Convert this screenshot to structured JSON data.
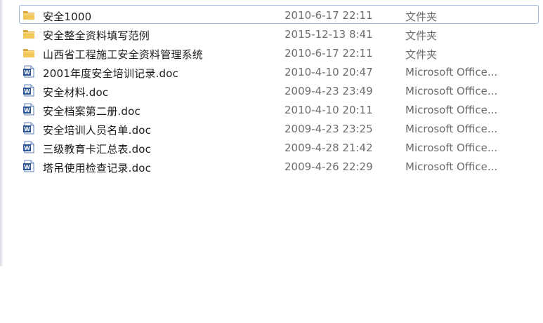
{
  "colors": {
    "folder": "#e8b84a",
    "doc_blue": "#2a5699",
    "selection_border": "#9dbbe0"
  },
  "files": [
    {
      "name": "安全1000",
      "date": "2010-6-17 22:11",
      "type": "文件夹",
      "icon": "folder-icon"
    },
    {
      "name": "安全整全资料填写范例",
      "date": "2015-12-13 8:41",
      "type": "文件夹",
      "icon": "folder-icon"
    },
    {
      "name": "山西省工程施工安全资料管理系统",
      "date": "2010-6-17 22:11",
      "type": "文件夹",
      "icon": "folder-icon"
    },
    {
      "name": "2001年度安全培训记录.doc",
      "date": "2010-4-10 20:47",
      "type": "Microsoft Office...",
      "icon": "word-doc-icon"
    },
    {
      "name": "安全材料.doc",
      "date": "2009-4-23 23:49",
      "type": "Microsoft Office...",
      "icon": "word-doc-icon"
    },
    {
      "name": "安全档案第二册.doc",
      "date": "2010-4-10 20:11",
      "type": "Microsoft Office...",
      "icon": "word-doc-icon"
    },
    {
      "name": "安全培训人员名单.doc",
      "date": "2009-4-23 23:25",
      "type": "Microsoft Office...",
      "icon": "word-doc-icon"
    },
    {
      "name": "三级教育卡汇总表.doc",
      "date": "2009-4-28 21:42",
      "type": "Microsoft Office...",
      "icon": "word-doc-icon"
    },
    {
      "name": "塔吊使用检查记录.doc",
      "date": "2009-4-26 22:29",
      "type": "Microsoft Office...",
      "icon": "word-doc-icon"
    }
  ]
}
